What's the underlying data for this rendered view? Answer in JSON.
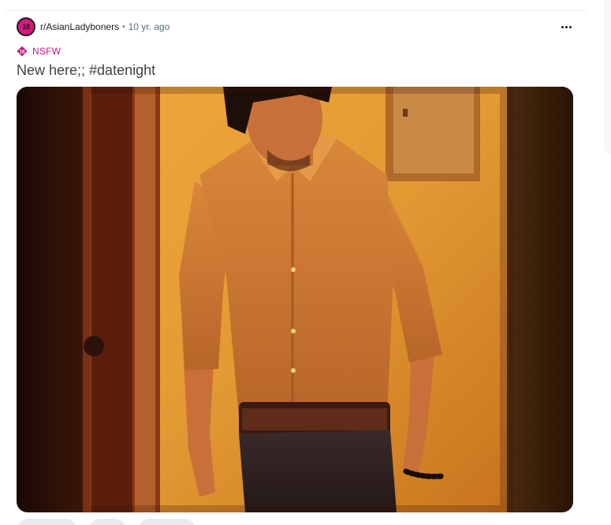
{
  "post": {
    "subreddit": "r/AsianLadyboners",
    "subreddit_avatar_text": "18",
    "separator": "•",
    "time": "10 yr. ago",
    "nsfw_label": "NSFW",
    "title": "New here;; #datenight",
    "image_description": "photo",
    "overflow_icon": "more-horizontal-icon",
    "nsfw_icon": "nsfw-diamond-icon"
  },
  "colors": {
    "nsfw_accent": "#c2188a",
    "avatar_bg": "#d4187e",
    "muted_text": "#576f76",
    "pill_bg": "#e5ebee"
  }
}
